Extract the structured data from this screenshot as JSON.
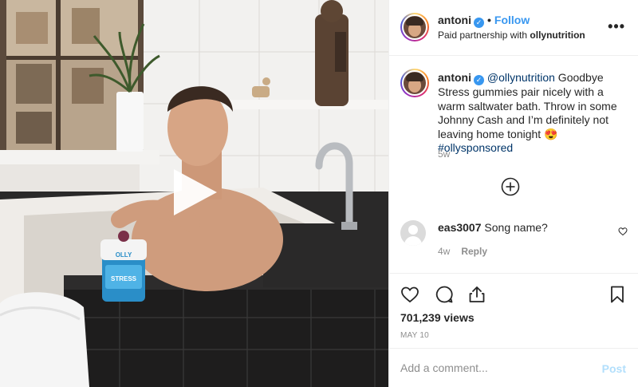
{
  "header": {
    "username": "antoni",
    "verified_icon": "verified-badge-icon",
    "separator": "•",
    "follow_label": "Follow",
    "partnership_prefix": "Paid partnership with ",
    "partner": "ollynutrition",
    "more_icon": "more-options-icon",
    "more_glyph": "•••"
  },
  "caption": {
    "username": "antoni",
    "mention": "@ollynutrition",
    "text": " Goodbye Stress gummies pair nicely with a warm saltwater bath. Throw in some Johnny Cash and I’m definitely not leaving home tonight 😍 ",
    "hashtag": "#ollysponsored",
    "time": "5w"
  },
  "load_more_icon": "plus-circle-icon",
  "comment": {
    "username": "eas3007",
    "text": " Song name?",
    "time": "4w",
    "reply_label": "Reply"
  },
  "actions": {
    "like_icon": "heart-icon",
    "comment_icon": "comment-icon",
    "share_icon": "share-icon",
    "save_icon": "bookmark-icon"
  },
  "views": "701,239 views",
  "date": "MAY 10",
  "add_comment": {
    "placeholder": "Add a comment...",
    "post_label": "Post"
  },
  "media": {
    "product_brand": "OLLY",
    "product_label": "STRESS",
    "play_icon": "play-icon"
  },
  "colors": {
    "link_blue": "#3897f0",
    "hashtag_navy": "#003569",
    "muted_gray": "#8e8e8e",
    "post_disabled": "#b2dffc"
  }
}
